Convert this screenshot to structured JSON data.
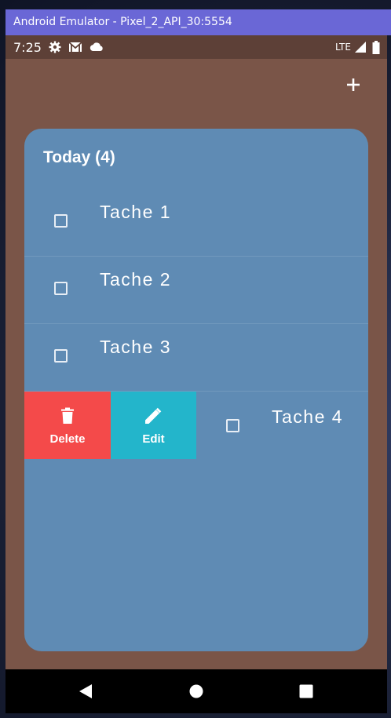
{
  "window": {
    "title": "Android Emulator - Pixel_2_API_30:5554"
  },
  "status_bar": {
    "time": "7:25",
    "network": "LTE",
    "icons": [
      "settings-icon",
      "gmail-icon",
      "cloud-icon",
      "signal-icon",
      "battery-icon"
    ]
  },
  "app": {
    "add_icon": "plus-icon",
    "colors": {
      "background": "#7a5548",
      "status_bar": "#5d4037",
      "card": "#5f8bb4",
      "delete": "#f44a4a",
      "edit": "#23b5cb"
    }
  },
  "list": {
    "title": "Today (4)",
    "tasks": [
      {
        "label": "Tache 1",
        "checked": false
      },
      {
        "label": "Tache 2",
        "checked": false
      },
      {
        "label": "Tache 3",
        "checked": false
      },
      {
        "label": "Tache 4",
        "checked": false
      }
    ],
    "swipe_actions": {
      "delete_label": "Delete",
      "edit_label": "Edit"
    }
  },
  "nav_bar": {
    "buttons": [
      "back-icon",
      "home-icon",
      "recents-icon"
    ]
  }
}
